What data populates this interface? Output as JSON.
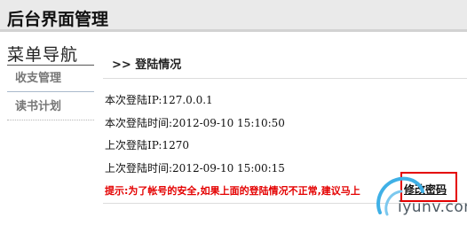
{
  "header": {
    "title": "后台界面管理"
  },
  "sidebar": {
    "title": "菜单导航",
    "items": [
      {
        "label": "收支管理"
      },
      {
        "label": "读书计划"
      }
    ]
  },
  "main": {
    "page_title": ">> 登陆情况",
    "lines": [
      "本次登陆IP:127.0.0.1",
      "本次登陆时间:2012-09-10 15:10:50",
      "上次登陆IP:1270",
      "上次登陆时间:2012-09-10 15:00:15"
    ],
    "tip": "提示:为了帐号的安全,如果上面的登陆情况不正常,建议马上",
    "action_label": "修改密码"
  },
  "watermark": {
    "text": "iyunv.com"
  },
  "colors": {
    "accent_red": "#e40000",
    "header_bg": "#eaeaea"
  }
}
